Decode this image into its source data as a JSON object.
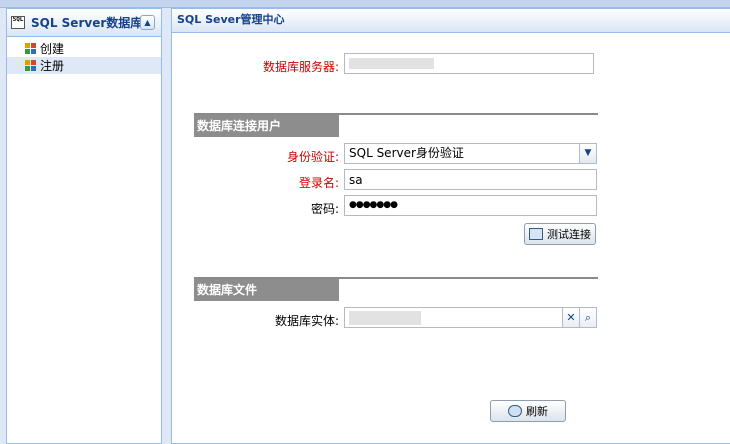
{
  "sidebar": {
    "title": "SQL Server数据库",
    "db_icon_text": "SQL",
    "collapse_glyph": "▲",
    "items": [
      {
        "label": "创建"
      },
      {
        "label": "注册",
        "selected": true
      }
    ]
  },
  "main": {
    "title": "SQL Sever管理中心",
    "server_label": "数据库服务器:",
    "server_value": "",
    "section_user": "数据库连接用户",
    "auth_label": "身份验证:",
    "auth_value": "SQL Server身份验证",
    "auth_dropdown_glyph": "▼",
    "login_label": "登录名:",
    "login_value": "sa",
    "password_label": "密码:",
    "password_value": "●●●●●●●",
    "test_button": "测试连接",
    "section_file": "数据库文件",
    "entity_label": "数据库实体:",
    "entity_value": "",
    "clear_glyph": "✕",
    "search_glyph": "⌕",
    "refresh_button": "刷新"
  },
  "colors": {
    "accent": "#15428b",
    "border": "#99bbe8",
    "required_label": "#cc0000",
    "section_bar": "#8d8d8d"
  }
}
